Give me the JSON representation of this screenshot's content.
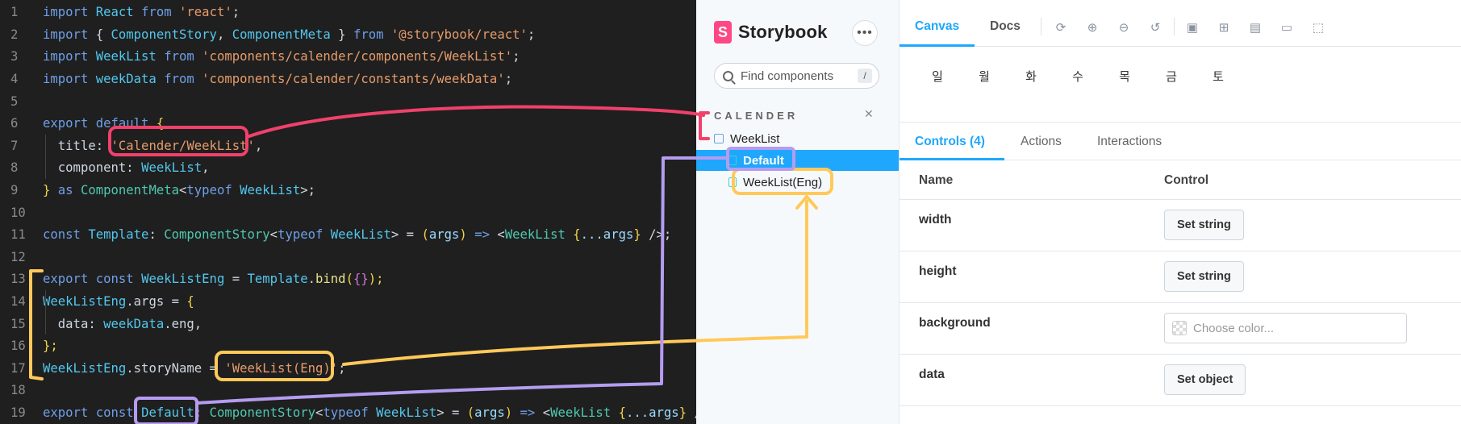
{
  "editor": {
    "lines": [
      {
        "n": "1",
        "tokens": [
          {
            "t": "import ",
            "c": "t-kw"
          },
          {
            "t": "React ",
            "c": "t-id"
          },
          {
            "t": "from ",
            "c": "t-kw"
          },
          {
            "t": "'react'",
            "c": "t-str"
          },
          {
            "t": ";",
            "c": "t-pl"
          }
        ]
      },
      {
        "n": "2",
        "tokens": [
          {
            "t": "import ",
            "c": "t-kw"
          },
          {
            "t": "{ ",
            "c": "t-pl"
          },
          {
            "t": "ComponentStory",
            "c": "t-id"
          },
          {
            "t": ", ",
            "c": "t-pl"
          },
          {
            "t": "ComponentMeta",
            "c": "t-id"
          },
          {
            "t": " } ",
            "c": "t-pl"
          },
          {
            "t": "from ",
            "c": "t-kw"
          },
          {
            "t": "'@storybook/react'",
            "c": "t-str"
          },
          {
            "t": ";",
            "c": "t-pl"
          }
        ]
      },
      {
        "n": "3",
        "tokens": [
          {
            "t": "import ",
            "c": "t-kw"
          },
          {
            "t": "WeekList ",
            "c": "t-id"
          },
          {
            "t": "from ",
            "c": "t-kw"
          },
          {
            "t": "'components/calender/components/WeekList'",
            "c": "t-str"
          },
          {
            "t": ";",
            "c": "t-pl"
          }
        ]
      },
      {
        "n": "4",
        "tokens": [
          {
            "t": "import ",
            "c": "t-kw"
          },
          {
            "t": "weekData ",
            "c": "t-id"
          },
          {
            "t": "from ",
            "c": "t-kw"
          },
          {
            "t": "'components/calender/constants/weekData'",
            "c": "t-str"
          },
          {
            "t": ";",
            "c": "t-pl"
          }
        ]
      },
      {
        "n": "5",
        "tokens": []
      },
      {
        "n": "6",
        "tokens": [
          {
            "t": "export ",
            "c": "t-kw"
          },
          {
            "t": "default ",
            "c": "t-kw"
          },
          {
            "t": "{",
            "c": "t-br"
          }
        ]
      },
      {
        "n": "7",
        "tokens": [
          {
            "t": "  title: ",
            "c": "t-pl"
          },
          {
            "t": "'Calender/WeekList'",
            "c": "t-str"
          },
          {
            "t": ",",
            "c": "t-pl"
          }
        ]
      },
      {
        "n": "8",
        "tokens": [
          {
            "t": "  component: ",
            "c": "t-pl"
          },
          {
            "t": "WeekList",
            "c": "t-id"
          },
          {
            "t": ",",
            "c": "t-pl"
          }
        ]
      },
      {
        "n": "9",
        "tokens": [
          {
            "t": "} ",
            "c": "t-br"
          },
          {
            "t": "as ",
            "c": "t-kw"
          },
          {
            "t": "ComponentMeta",
            "c": "t-ty"
          },
          {
            "t": "<",
            "c": "t-pl"
          },
          {
            "t": "typeof ",
            "c": "t-kw"
          },
          {
            "t": "WeekList",
            "c": "t-id"
          },
          {
            "t": ">;",
            "c": "t-pl"
          }
        ]
      },
      {
        "n": "10",
        "tokens": []
      },
      {
        "n": "11",
        "tokens": [
          {
            "t": "const ",
            "c": "t-kw"
          },
          {
            "t": "Template",
            "c": "t-id"
          },
          {
            "t": ": ",
            "c": "t-pl"
          },
          {
            "t": "ComponentStory",
            "c": "t-ty"
          },
          {
            "t": "<",
            "c": "t-pl"
          },
          {
            "t": "typeof ",
            "c": "t-kw"
          },
          {
            "t": "WeekList",
            "c": "t-id"
          },
          {
            "t": "> = ",
            "c": "t-pl"
          },
          {
            "t": "(",
            "c": "t-br"
          },
          {
            "t": "args",
            "c": "t-prop"
          },
          {
            "t": ") ",
            "c": "t-br"
          },
          {
            "t": "=> ",
            "c": "t-kw"
          },
          {
            "t": "<",
            "c": "t-pl"
          },
          {
            "t": "WeekList ",
            "c": "t-ty"
          },
          {
            "t": "{",
            "c": "t-br"
          },
          {
            "t": "...args",
            "c": "t-prop"
          },
          {
            "t": "} ",
            "c": "t-br"
          },
          {
            "t": "/>;",
            "c": "t-pl"
          }
        ]
      },
      {
        "n": "12",
        "tokens": []
      },
      {
        "n": "13",
        "tokens": [
          {
            "t": "export ",
            "c": "t-kw"
          },
          {
            "t": "const ",
            "c": "t-kw"
          },
          {
            "t": "WeekListEng ",
            "c": "t-id"
          },
          {
            "t": "= ",
            "c": "t-pl"
          },
          {
            "t": "Template",
            "c": "t-id"
          },
          {
            "t": ".",
            "c": "t-pl"
          },
          {
            "t": "bind",
            "c": "t-fn"
          },
          {
            "t": "(",
            "c": "t-br"
          },
          {
            "t": "{}",
            "c": "t-br2"
          },
          {
            "t": ");",
            "c": "t-br"
          }
        ]
      },
      {
        "n": "14",
        "tokens": [
          {
            "t": "WeekListEng",
            "c": "t-id"
          },
          {
            "t": ".args = ",
            "c": "t-pl"
          },
          {
            "t": "{",
            "c": "t-br"
          }
        ]
      },
      {
        "n": "15",
        "tokens": [
          {
            "t": "  data: ",
            "c": "t-pl"
          },
          {
            "t": "weekData",
            "c": "t-id"
          },
          {
            "t": ".eng,",
            "c": "t-pl"
          }
        ]
      },
      {
        "n": "16",
        "tokens": [
          {
            "t": "};",
            "c": "t-br"
          }
        ]
      },
      {
        "n": "17",
        "tokens": [
          {
            "t": "WeekListEng",
            "c": "t-id"
          },
          {
            "t": ".storyName = ",
            "c": "t-pl"
          },
          {
            "t": "'WeekList(Eng)'",
            "c": "t-str"
          },
          {
            "t": ";",
            "c": "t-pl"
          }
        ]
      },
      {
        "n": "18",
        "tokens": []
      },
      {
        "n": "19",
        "tokens": [
          {
            "t": "export ",
            "c": "t-kw"
          },
          {
            "t": "const ",
            "c": "t-kw"
          },
          {
            "t": "Default",
            "c": "t-id"
          },
          {
            "t": ": ",
            "c": "t-pl"
          },
          {
            "t": "ComponentStory",
            "c": "t-ty"
          },
          {
            "t": "<",
            "c": "t-pl"
          },
          {
            "t": "typeof ",
            "c": "t-kw"
          },
          {
            "t": "WeekList",
            "c": "t-id"
          },
          {
            "t": "> = ",
            "c": "t-pl"
          },
          {
            "t": "(",
            "c": "t-br"
          },
          {
            "t": "args",
            "c": "t-prop"
          },
          {
            "t": ") ",
            "c": "t-br"
          },
          {
            "t": "=> ",
            "c": "t-kw"
          },
          {
            "t": "<",
            "c": "t-pl"
          },
          {
            "t": "WeekList ",
            "c": "t-ty"
          },
          {
            "t": "{",
            "c": "t-br"
          },
          {
            "t": "...args",
            "c": "t-prop"
          },
          {
            "t": "} ",
            "c": "t-br"
          },
          {
            "t": "/>;",
            "c": "t-pl"
          }
        ]
      }
    ]
  },
  "sidebar": {
    "logo_mark": "S",
    "logo_text": "Storybook",
    "menu_glyph": "•••",
    "search_placeholder": "Find components",
    "search_shortcut": "/",
    "group_label": "CALENDER",
    "collapse_glyph": "✕",
    "items": [
      {
        "label": "WeekList",
        "kind": "component",
        "selected": false
      },
      {
        "label": "Default",
        "kind": "story",
        "selected": true
      },
      {
        "label": "WeekList(Eng)",
        "kind": "story",
        "selected": false
      }
    ]
  },
  "preview": {
    "tabs": [
      {
        "label": "Canvas",
        "active": true
      },
      {
        "label": "Docs",
        "active": false
      }
    ],
    "toolbar_icons": [
      "reload-icon",
      "zoom-in-icon",
      "zoom-out-icon",
      "zoom-reset-icon",
      "background-icon",
      "grid-icon",
      "viewport-icon",
      "measure-icon",
      "outline-icon"
    ],
    "weekdays": [
      "일",
      "월",
      "화",
      "수",
      "목",
      "금",
      "토"
    ]
  },
  "addons": {
    "tabs": [
      {
        "label": "Controls (4)",
        "active": true
      },
      {
        "label": "Actions",
        "active": false
      },
      {
        "label": "Interactions",
        "active": false
      }
    ],
    "columns": {
      "name": "Name",
      "control": "Control"
    },
    "rows": [
      {
        "name": "width",
        "control_type": "button",
        "control_label": "Set string"
      },
      {
        "name": "height",
        "control_type": "button",
        "control_label": "Set string"
      },
      {
        "name": "background",
        "control_type": "color",
        "placeholder": "Choose color..."
      },
      {
        "name": "data",
        "control_type": "button",
        "control_label": "Set object"
      }
    ]
  },
  "colors": {
    "accent": "#1ea7fd",
    "annotation_pink": "#f0416b",
    "annotation_purple": "#b49cf0",
    "annotation_yellow": "#ffc95a"
  }
}
